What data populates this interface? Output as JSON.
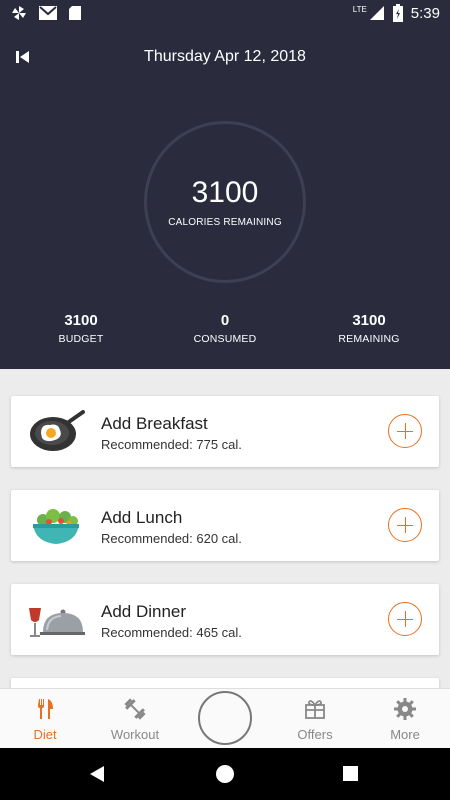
{
  "status_bar": {
    "time": "5:39",
    "network": "LTE",
    "icons": [
      "pinwheel-icon",
      "gmail-icon",
      "sd-card-icon",
      "signal-icon",
      "battery-icon"
    ]
  },
  "header": {
    "date": "Thursday Apr 12, 2018",
    "calories_remaining_value": "3100",
    "calories_remaining_label": "CALORIES REMAINING",
    "stats": [
      {
        "value": "3100",
        "label": "BUDGET"
      },
      {
        "value": "0",
        "label": "CONSUMED"
      },
      {
        "value": "3100",
        "label": "REMAINING"
      }
    ]
  },
  "meals": [
    {
      "title": "Add Breakfast",
      "subtitle": "Recommended: 775 cal.",
      "icon": "frying-pan-egg-icon"
    },
    {
      "title": "Add Lunch",
      "subtitle": "Recommended: 620 cal.",
      "icon": "salad-bowl-icon"
    },
    {
      "title": "Add Dinner",
      "subtitle": "Recommended: 465 cal.",
      "icon": "dinner-cloche-icon"
    }
  ],
  "bottom_nav": {
    "items": [
      {
        "label": "Diet",
        "icon": "fork-knife-icon",
        "active": true
      },
      {
        "label": "Workout",
        "icon": "dumbbell-icon",
        "active": false
      },
      {
        "label": "Offers",
        "icon": "gift-icon",
        "active": false
      },
      {
        "label": "More",
        "icon": "gear-icon",
        "active": false
      }
    ]
  },
  "colors": {
    "header_bg": "#2a2c3e",
    "accent": "#e8711f",
    "page_bg": "#ececec"
  }
}
